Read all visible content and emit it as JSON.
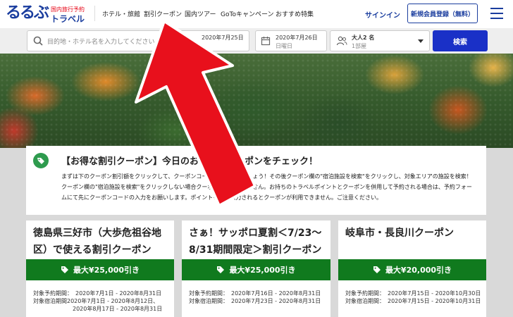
{
  "header": {
    "logo_main": "るるぶ",
    "logo_sub1": "国内旅行予約",
    "logo_sub2": "トラベル",
    "nav": [
      "ホテル・旅館",
      "割引クーポン",
      "国内ツアー",
      "GoToキャンペーン",
      "おすすめ特集"
    ],
    "signin": "サインイン",
    "register": "新規会員登録（無料）"
  },
  "search": {
    "destination_placeholder": "目的地・ホテル名を入力してください",
    "checkin_date": "2020年7月25日",
    "checkout_date": "2020年7月26日",
    "checkout_day": "日曜日",
    "guests": "大人2 名",
    "rooms": "1部屋",
    "search_button": "検索"
  },
  "notice": {
    "title": "【お得な割引クーポン】今日のおトクなクーポンをチェック！",
    "body": "まずは下のクーポン割引額をクリックして、クーポンコードをコピーしましょう！その後クーポン欄の\"宿泊施設を検索\"をクリックし、対象エリアの施設を検索！クーポン欄の\"宿泊施設を検索\"をクリックしない場合クーポンは利用できません。お持ちのトラベルポイントとクーポンを併用して予約される場合は、予約フォームにて先にクーポンコードの入力をお願いします。ポイントを先に入力されるとクーポンが利用できません。ご注意ください。"
  },
  "coupons": [
    {
      "title": "徳島県三好市（大歩危祖谷地区）で使える割引クーポン",
      "discount": "最大¥25,000引き",
      "dates": "対象予約期間：　2020年7月1日 - 2020年8月31日\n対象宿泊期間2020年7月1日 - 2020年8月12日、\n　　　　　　　2020年8月17日 - 2020年8月31日"
    },
    {
      "title": "さぁ！サッポロ夏割＜7/23～8/31期間限定＞割引クーポン",
      "discount": "最大¥25,000引き",
      "dates": "対象予約期間：　2020年7月16日 - 2020年8月31日\n対象宿泊期間：　2020年7月23日 - 2020年8月31日\n"
    },
    {
      "title": "岐阜市・長良川クーポン",
      "discount": "最大¥20,000引き",
      "dates": "対象予約期間：　2020年7月15日 - 2020年10月30日\n対象宿泊期間：　2020年7月15日 - 2020年10月31日\n"
    }
  ],
  "colors": {
    "brand": "#1a3d9e",
    "search_button": "#1a30c7",
    "coupon_button": "#107a1e",
    "arrow": "#e8101c"
  }
}
